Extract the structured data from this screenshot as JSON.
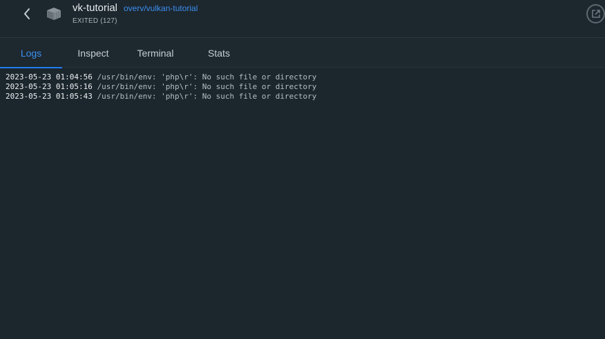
{
  "header": {
    "container_name": "vk-tutorial",
    "image_name": "overv/vulkan-tutorial",
    "status": "EXITED (127)",
    "icons": {
      "back": "chevron-left-icon",
      "container": "container-box-icon",
      "open": "open-external-icon"
    }
  },
  "tabs": [
    {
      "label": "Logs",
      "active": true
    },
    {
      "label": "Inspect",
      "active": false
    },
    {
      "label": "Terminal",
      "active": false
    },
    {
      "label": "Stats",
      "active": false
    }
  ],
  "logs": [
    {
      "timestamp": "2023-05-23 01:04:56",
      "message": " /usr/bin/env: 'php\\r': No such file or directory"
    },
    {
      "timestamp": "2023-05-23 01:05:16",
      "message": " /usr/bin/env: 'php\\r': No such file or directory"
    },
    {
      "timestamp": "2023-05-23 01:05:43",
      "message": " /usr/bin/env: 'php\\r': No such file or directory"
    }
  ],
  "colors": {
    "accent": "#1e7ff0",
    "link": "#3b8ff0",
    "background": "#1c262d"
  }
}
